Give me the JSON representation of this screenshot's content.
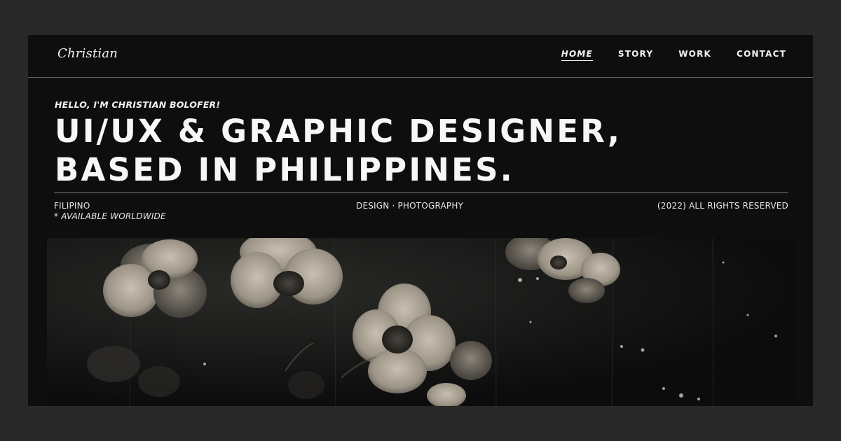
{
  "brand": {
    "logo": "Christian"
  },
  "nav": {
    "items": [
      {
        "label": "HOME",
        "active": true
      },
      {
        "label": "STORY",
        "active": false
      },
      {
        "label": "WORK",
        "active": false
      },
      {
        "label": "CONTACT",
        "active": false
      }
    ]
  },
  "hero": {
    "greeting": "HELLO, I'M CHRISTIAN BOLOFER!",
    "headline_line1": "UI/UX & GRAPHIC DESIGNER,",
    "headline_line2": "BASED IN PHILIPPINES."
  },
  "meta": {
    "nationality": "FILIPINO",
    "availability": "* AVAILABLE WORLDWIDE",
    "services": "DESIGN · PHOTOGRAPHY",
    "copyright": "(2022) ALL RIGHTS RESERVED"
  },
  "image": {
    "subject": "flowers-photo"
  },
  "colors": {
    "outer_background": "#282828",
    "page_background": "#0e0e0e",
    "text": "#f2f2f2",
    "divider": "#7a7a7a"
  }
}
